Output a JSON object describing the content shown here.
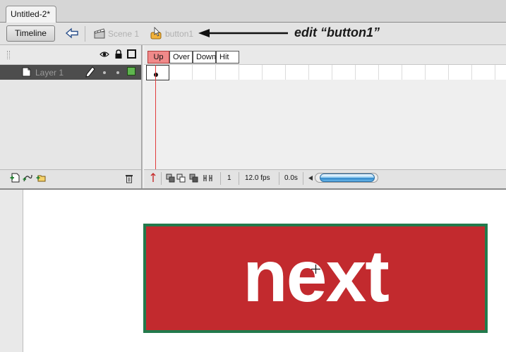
{
  "document": {
    "tab_title": "Untitled-2*"
  },
  "edit_bar": {
    "timeline_button": "Timeline",
    "scene_label": "Scene 1",
    "symbol_label": "button1",
    "callout": "edit “button1”"
  },
  "layers": [
    {
      "name": "Layer 1",
      "color": "#5fb54f",
      "selected": true
    }
  ],
  "frame_labels": [
    "Up",
    "Over",
    "Down",
    "Hit"
  ],
  "status": {
    "current_frame": "1",
    "frame_rate": "12.0 fps",
    "elapsed_time": "0.0s"
  },
  "stage": {
    "button_text": "next",
    "button_fill": "#c22a2e",
    "button_stroke": "#237a4c"
  },
  "colors": {
    "playhead": "#e23b3b",
    "active_frame_label": "#f08a8a",
    "layer_row": "#4d4d4d"
  },
  "icons": [
    "back-arrow-icon",
    "scene-clapper-icon",
    "button-symbol-icon",
    "eye-icon",
    "lock-icon",
    "outline-icon",
    "layer-page-icon",
    "pencil-icon",
    "add-layer-icon",
    "add-motion-guide-icon",
    "add-folder-icon",
    "trash-icon",
    "center-frame-icon",
    "onion-skin-icon",
    "onion-skin-outlines-icon",
    "edit-multiple-frames-icon",
    "modify-onion-markers-icon",
    "scroll-left-icon",
    "registration-cross-icon"
  ]
}
